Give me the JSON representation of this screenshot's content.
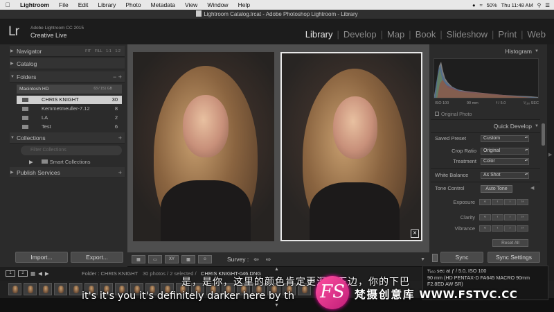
{
  "menubar": {
    "app": "Lightroom",
    "items": [
      "File",
      "Edit",
      "Library",
      "Photo",
      "Metadata",
      "View",
      "Window",
      "Help"
    ],
    "battery": "50%",
    "time": "Thu 11:48 AM"
  },
  "window_title": "Lightroom Catalog.lrcat - Adobe Photoshop Lightroom - Library",
  "identity": {
    "logo": "Lr",
    "product": "Adobe Lightroom CC 2015",
    "name": "Creative Live"
  },
  "modules": [
    "Library",
    "Develop",
    "Map",
    "Book",
    "Slideshow",
    "Print",
    "Web"
  ],
  "left_panel": {
    "navigator": "Navigator",
    "navigator_opts": "FIT FILL 1:1 1:2",
    "catalog": "Catalog",
    "folders": "Folders",
    "volume": "Macintosh HD",
    "volume_size": "63 / 151 GB",
    "folder_items": [
      {
        "name": "CHRIS KNIGHT",
        "count": "30"
      },
      {
        "name": "Kemmetmeuller-7.12",
        "count": "8"
      },
      {
        "name": "LA",
        "count": "2"
      },
      {
        "name": "Test",
        "count": "6"
      }
    ],
    "collections": "Collections",
    "collection_filter": "Filter Collections",
    "smart_collections": "Smart Collections",
    "publish_services": "Publish Services",
    "import_label": "Import...",
    "export_label": "Export..."
  },
  "toolbar": {
    "survey_label": "Survey :"
  },
  "right_panel": {
    "histogram": "Histogram",
    "iso": "ISO 100",
    "focal": "90 mm",
    "aperture": "f / 5.0",
    "shutter": "¹⁄₁₆₀ SEC",
    "original_photo": "Original Photo",
    "quick_develop": "Quick Develop",
    "saved_preset_label": "Saved Preset",
    "saved_preset": "Custom",
    "crop_ratio_label": "Crop Ratio",
    "crop_ratio": "Original",
    "treatment_label": "Treatment",
    "treatment": "Color",
    "white_balance_label": "White Balance",
    "white_balance": "As Shot",
    "tone_control_label": "Tone Control",
    "auto_tone": "Auto Tone",
    "exposure": "Exposure",
    "clarity": "Clarity",
    "vibrance": "Vibrance",
    "reset_all": "Reset All",
    "sync": "Sync",
    "sync_settings": "Sync Settings"
  },
  "filmstrip": {
    "screen1": "1",
    "screen2": "2",
    "folder_label": "Folder : CHRIS KNIGHT",
    "photo_count": "30 photos / 2 selected /",
    "filename": "CHRIS KNIGHT-046.DNG"
  },
  "exif": {
    "line1": "¹⁄₁₆₀ sec at ƒ / 5.0, ISO 100",
    "line2": "90 mm (HD PENTAX-D FA645 MACRO 90mm",
    "line3": "F2.8ED AW SR)"
  },
  "subtitles": {
    "chinese": "是，是你，这里的颜色肯定更深，下边，你的下巴",
    "english": "it's it's you it's definitely darker here by th"
  },
  "watermark": {
    "logo": "FS",
    "text": "梵摄创意库",
    "url": "WWW.FSTVC.CC"
  }
}
